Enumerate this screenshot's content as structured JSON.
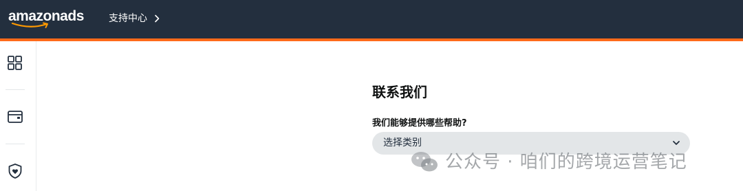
{
  "brand": {
    "logo_text": "amazonads",
    "colors": {
      "header_bg": "#232f3e",
      "accent": "#ff6a1a",
      "select_bg": "#e3e6e8"
    }
  },
  "header": {
    "breadcrumb_label": "支持中心",
    "breadcrumb_icon": "chevron-right-icon"
  },
  "sidebar": {
    "items": [
      {
        "icon": "dashboard-grid-icon"
      },
      {
        "icon": "wallet-icon"
      },
      {
        "icon": "shield-heart-icon"
      }
    ]
  },
  "main": {
    "title": "联系我们",
    "question": "我们能够提供哪些帮助?",
    "category_select": {
      "value": "选择类别",
      "icon": "chevron-down-icon"
    }
  },
  "watermark": {
    "text": "公众号 · 咱们的跨境运营笔记",
    "icon": "wechat-icon"
  }
}
